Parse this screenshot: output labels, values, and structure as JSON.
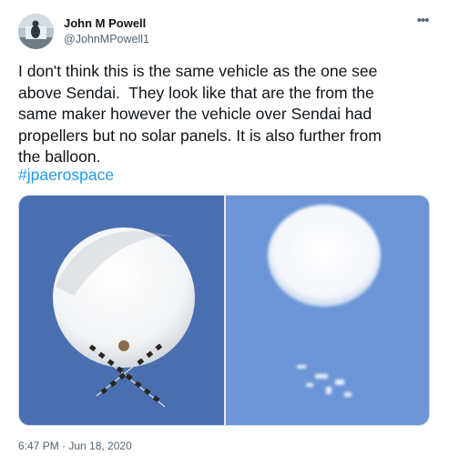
{
  "author": {
    "name": "John M Powell",
    "handle": "@JohnMPowell1",
    "avatar_icon": "profile-photo"
  },
  "more_icon": "more-horizontal-icon",
  "tweet": {
    "text": "I don't think this is the same vehicle as the one see\nabove Sendai.  They look like that are the from the\nsame maker however the vehicle over Sendai had\npropellers but no solar panels. It is also further from\nthe balloon.",
    "hashtag": "#jpaerospace"
  },
  "media": {
    "images": [
      {
        "subject": "white balloon with solar panel cross frame",
        "sky_color": "#4a6fb0"
      },
      {
        "subject": "white balloon in hazy blue sky with small payload",
        "sky_color": "#6b95d6"
      }
    ]
  },
  "timestamp": "6:47 PM · Jun 18, 2020",
  "colors": {
    "text": "#0f1419",
    "secondary": "#536471",
    "link": "#1d9bf0",
    "border": "#cfd9de"
  }
}
